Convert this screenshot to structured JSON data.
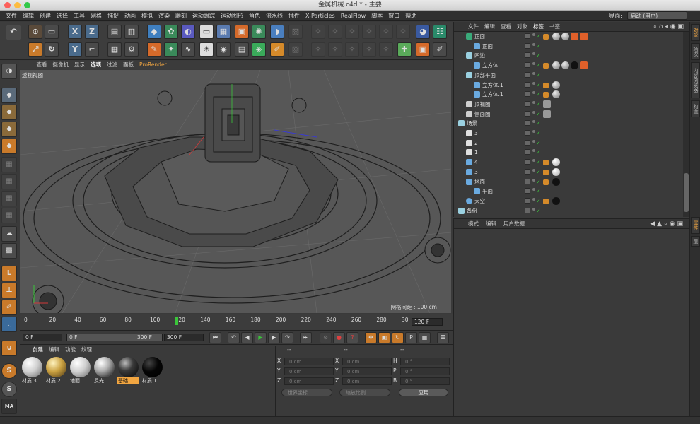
{
  "window": {
    "title": "金属机械.c4d * - 主要"
  },
  "menu": {
    "items": [
      "文件",
      "编辑",
      "创建",
      "选择",
      "工具",
      "网格",
      "捕捉",
      "动画",
      "模拟",
      "渲染",
      "雕刻",
      "运动跟踪",
      "运动图形",
      "角色",
      "流水线",
      "插件",
      "X-Particles",
      "RealFlow",
      "脚本",
      "窗口",
      "帮助"
    ],
    "layout_label": "界面:",
    "layout_value": "启动 (用户)"
  },
  "viewport": {
    "menu": [
      "查看",
      "摄像机",
      "显示",
      "选项",
      "过滤",
      "面板",
      "ProRender"
    ],
    "label": "透视视图",
    "grid_label": "网格间距 : 100 cm"
  },
  "timeline": {
    "ticks": [
      "0",
      "20",
      "40",
      "60",
      "80",
      "100",
      "120",
      "140",
      "160",
      "180",
      "200",
      "220",
      "240",
      "260",
      "280",
      "30"
    ],
    "current_frame_marker": "120",
    "end_field": "120 F",
    "current_field": "0 F",
    "range_start": "0 F",
    "range_end": "300 F",
    "max_field": "300 F"
  },
  "materials": {
    "tabs": [
      "创建",
      "编辑",
      "功能",
      "纹理"
    ],
    "items": [
      {
        "name": "材质.3",
        "style": "white"
      },
      {
        "name": "材质.2",
        "style": "gold"
      },
      {
        "name": "地面",
        "style": "white"
      },
      {
        "name": "反光",
        "style": "chrome"
      },
      {
        "name": "基础",
        "style": "dark",
        "selected": true
      },
      {
        "name": "材质.1",
        "style": "black"
      }
    ]
  },
  "coords": {
    "headers": [
      "--",
      "--",
      "--"
    ],
    "rows": [
      {
        "a": "X",
        "av": "0 cm",
        "b": "X",
        "bv": "0 cm",
        "c": "H",
        "cv": "0 °"
      },
      {
        "a": "Y",
        "av": "0 cm",
        "b": "Y",
        "bv": "0 cm",
        "c": "P",
        "cv": "0 °"
      },
      {
        "a": "Z",
        "av": "0 cm",
        "b": "Z",
        "bv": "0 cm",
        "c": "B",
        "cv": "0 °"
      }
    ],
    "world_dd": "世界坐标",
    "scale_dd": "缩放比例",
    "apply": "应用"
  },
  "objects": {
    "menu": [
      "文件",
      "编辑",
      "查看",
      "对象",
      "标签",
      "书签"
    ],
    "rows": [
      {
        "name": "正面",
        "indent": 1,
        "icon": "sky"
      },
      {
        "name": "正面",
        "indent": 2,
        "icon": "cube"
      },
      {
        "name": "四边",
        "indent": 1,
        "icon": "null"
      },
      {
        "name": "立方体",
        "indent": 2,
        "icon": "cube"
      },
      {
        "name": "顶部平面",
        "indent": 1,
        "icon": "null"
      },
      {
        "name": "立方体.1",
        "indent": 2,
        "icon": "cube"
      },
      {
        "name": "立方体.1",
        "indent": 2,
        "icon": "cube"
      },
      {
        "name": "顶视图",
        "indent": 1,
        "icon": "cam"
      },
      {
        "name": "侧面图",
        "indent": 1,
        "icon": "cam"
      },
      {
        "name": "场景",
        "indent": 0,
        "icon": "null"
      },
      {
        "name": "3",
        "indent": 1,
        "icon": "plane"
      },
      {
        "name": "2",
        "indent": 1,
        "icon": "plane"
      },
      {
        "name": "1",
        "indent": 1,
        "icon": "plane"
      },
      {
        "name": "4",
        "indent": 1,
        "icon": "light"
      },
      {
        "name": "3",
        "indent": 1,
        "icon": "light"
      },
      {
        "name": "地面",
        "indent": 1,
        "icon": "floor"
      },
      {
        "name": "平面",
        "indent": 2,
        "icon": "light"
      },
      {
        "name": "天空",
        "indent": 1,
        "icon": "skyball"
      },
      {
        "name": "备份",
        "indent": 0,
        "icon": "null"
      }
    ]
  },
  "attributes": {
    "menu": [
      "模式",
      "编辑",
      "用户数据"
    ]
  },
  "right_tabs": [
    "对象",
    "场次",
    "内容浏览器",
    "构造"
  ],
  "right_tabs2": [
    "属性",
    "层"
  ],
  "colors": {
    "accent": "#f2a641",
    "selected_tab": "#f2a641",
    "play": "#3ac63a"
  }
}
